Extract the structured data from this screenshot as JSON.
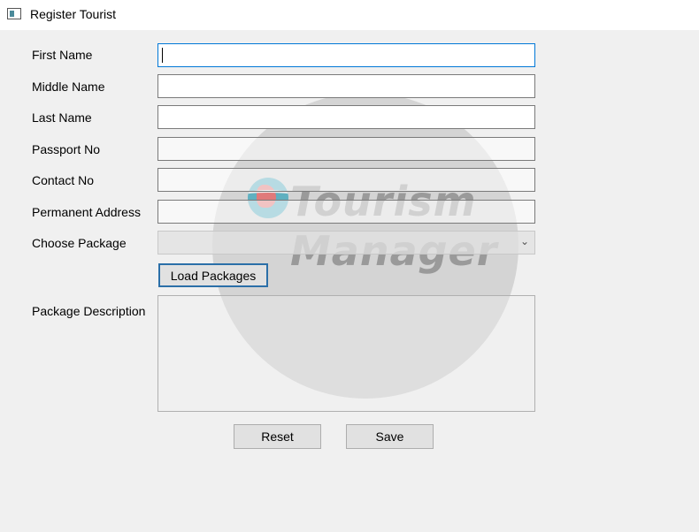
{
  "window": {
    "title": "Register Tourist",
    "icon": "window-app-icon"
  },
  "watermark": {
    "line1": "Tourism",
    "line2": "Manager"
  },
  "form": {
    "first_name_label": "First Name",
    "middle_name_label": "Middle Name",
    "last_name_label": "Last Name",
    "passport_label": "Passport No",
    "contact_label": "Contact No",
    "address_label": "Permanent Address",
    "package_label": "Choose Package",
    "description_label": "Package Description",
    "first_name_value": "",
    "middle_name_value": "",
    "last_name_value": "",
    "passport_value": "",
    "contact_value": "",
    "address_value": "",
    "package_value": ""
  },
  "buttons": {
    "load_packages": "Load Packages",
    "reset": "Reset",
    "save": "Save"
  },
  "colors": {
    "focus_border": "#0078d7",
    "button_primary_border": "#2b6fa8"
  }
}
